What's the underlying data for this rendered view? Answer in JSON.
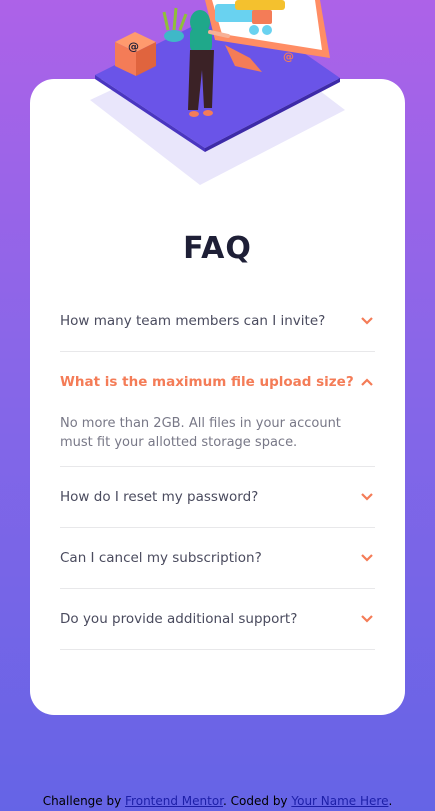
{
  "page": {
    "title": "FAQ"
  },
  "faq": {
    "items": [
      {
        "question": "How many team members can I invite?",
        "answer": "",
        "open": false
      },
      {
        "question": "What is the maximum file upload size?",
        "answer": "No more than 2GB. All files in your account must fit your allotted storage space.",
        "open": true
      },
      {
        "question": "How do I reset my password?",
        "answer": "",
        "open": false
      },
      {
        "question": "Can I cancel my subscription?",
        "answer": "",
        "open": false
      },
      {
        "question": "Do you provide additional support?",
        "answer": "",
        "open": false
      }
    ]
  },
  "attribution": {
    "prefix": "Challenge by ",
    "link1": "Frontend Mentor",
    "middle": ". Coded by ",
    "link2": "Your Name Here",
    "suffix": "."
  },
  "colors": {
    "gradient_top": "#ad62e8",
    "gradient_bottom": "#6564e6",
    "accent": "#f47c57",
    "title": "#1e1f36",
    "text": "#4a4b5e",
    "answer": "#787887"
  },
  "icons": {
    "chevron": "chevron-down-icon",
    "chevron_open": "chevron-up-icon",
    "illustration": "woman-at-computer-illustration"
  }
}
